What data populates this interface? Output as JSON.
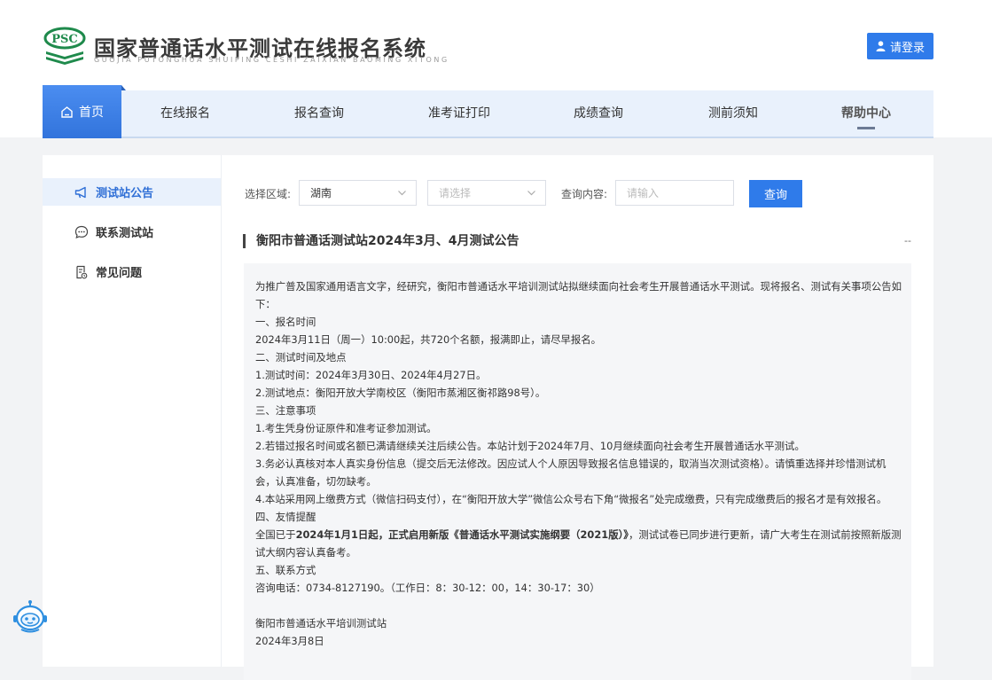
{
  "header": {
    "logo_text": "PSC",
    "title": "国家普通话水平测试在线报名系统",
    "subtitle": "GUOJIA PUTONGHUA SHUIPING CESHI ZAIXIAN BAOMING XITONG",
    "login_label": "请登录",
    "login_icon": "user-icon"
  },
  "nav": {
    "home": "首页",
    "items": [
      "在线报名",
      "报名查询",
      "准考证打印",
      "成绩查询",
      "测前须知",
      "帮助中心"
    ],
    "active": "帮助中心"
  },
  "sidebar": {
    "items": [
      {
        "label": "测试站公告",
        "icon": "megaphone-icon"
      },
      {
        "label": "联系测试站",
        "icon": "chat-icon"
      },
      {
        "label": "常见问题",
        "icon": "document-icon"
      }
    ]
  },
  "filters": {
    "region_label": "选择区域:",
    "region_value": "湖南",
    "station_placeholder": "请选择",
    "query_label": "查询内容:",
    "query_placeholder": "请输入",
    "query_button": "查询"
  },
  "notice": {
    "title": "衡阳市普通话测试站2024年3月、4月测试公告",
    "collapse": "--",
    "lines": [
      "为推广普及国家通用语言文字，经研究，衡阳市普通话水平培训测试站拟继续面向社会考生开展普通话水平测试。现将报名、测试有关事项公告如下：",
      "一、报名时间",
      "2024年3月11日（周一）10:00起，共720个名额，报满即止，请尽早报名。",
      "二、测试时间及地点",
      "1.测试时间：2024年3月30日、2024年4月27日。",
      "2.测试地点：衡阳开放大学南校区（衡阳市蒸湘区衡祁路98号）。",
      "三、注意事项",
      "1.考生凭身份证原件和准考证参加测试。",
      "2.若错过报名时间或名额已满请继续关注后续公告。本站计划于2024年7月、10月继续面向社会考生开展普通话水平测试。",
      "3.务必认真核对本人真实身份信息（提交后无法修改。因应试人个人原因导致报名信息错误的，取消当次测试资格）。请慎重选择并珍惜测试机会，认真准备，切勿缺考。",
      "4.本站采用网上缴费方式（微信扫码支付），在“衡阳开放大学”微信公众号右下角“微报名”处完成缴费，只有完成缴费后的报名才是有效报名。",
      "四、友情提醒"
    ],
    "reminder_prefix": "全国已于",
    "reminder_bold": "2024年1月1日起，正式启用新版《普通话水平测试实施纲要（2021版）》",
    "reminder_suffix": "，测试试卷已同步进行更新，请广大考生在测试前按照新版测试大纲内容认真备考。",
    "contact_heading": "五、联系方式",
    "contact_line": "咨询电话：0734-8127190。（工作日：8：30-12：00，14：30-17：30）",
    "signature": "衡阳市普通话水平培训测试站",
    "date": "2024年3月8日"
  },
  "colors": {
    "primary": "#2f7bea",
    "nav_bg": "#e9f1fc",
    "logo_green": "#1f8a4c"
  }
}
